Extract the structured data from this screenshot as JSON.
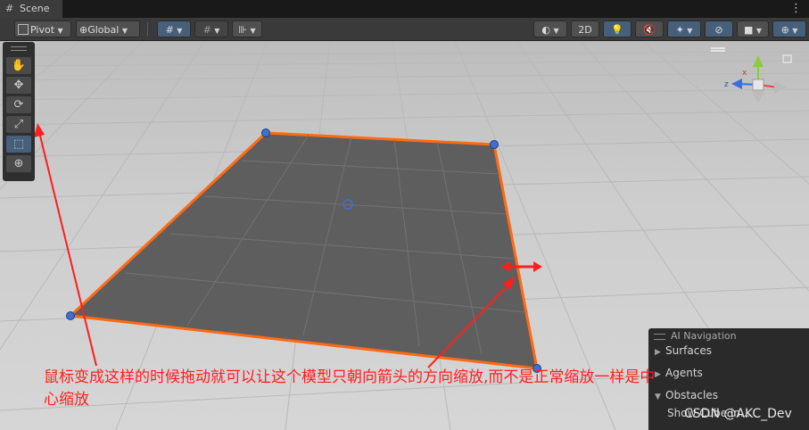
{
  "tab": {
    "title": "Scene",
    "icon": "grid-icon"
  },
  "toolbar": {
    "pivot_label": "Pivot",
    "global_label": "Global",
    "mode_2d_label": "2D"
  },
  "tools": [
    {
      "name": "hand-tool",
      "icon": "hand-icon",
      "glyph": "✋"
    },
    {
      "name": "move-tool",
      "icon": "move-icon",
      "glyph": "✥"
    },
    {
      "name": "rotate-tool",
      "icon": "rotate-icon",
      "glyph": "⟳"
    },
    {
      "name": "scale-tool",
      "icon": "scale-icon",
      "glyph": "⤢"
    },
    {
      "name": "rect-tool",
      "icon": "rect-icon",
      "glyph": "⬚",
      "selected": true
    },
    {
      "name": "transform-tool",
      "icon": "transform-icon",
      "glyph": "⊕"
    }
  ],
  "gizmo": {
    "x_label": "x",
    "z_label": "z"
  },
  "nav_panel": {
    "title": "AI Navigation",
    "items": [
      {
        "label": "Surfaces",
        "expanded": false
      },
      {
        "label": "Agents",
        "expanded": false
      },
      {
        "label": "Obstacles",
        "expanded": true
      },
      {
        "label": "Show Cube in..."
      }
    ]
  },
  "annotation": {
    "text": "鼠标变成这样的时候拖动就可以让这个模型只朝向箭头的方向缩放,而不是正常缩放一样是中心缩放",
    "color": "#ff1e1e"
  },
  "watermark": "CSDN @AKC_Dev",
  "colors": {
    "outline": "#ff6a14",
    "plane": "#5e5e5e",
    "handle": "#3d6fd6",
    "arrow": "#ff1e1e",
    "active_button": "#46607c"
  }
}
